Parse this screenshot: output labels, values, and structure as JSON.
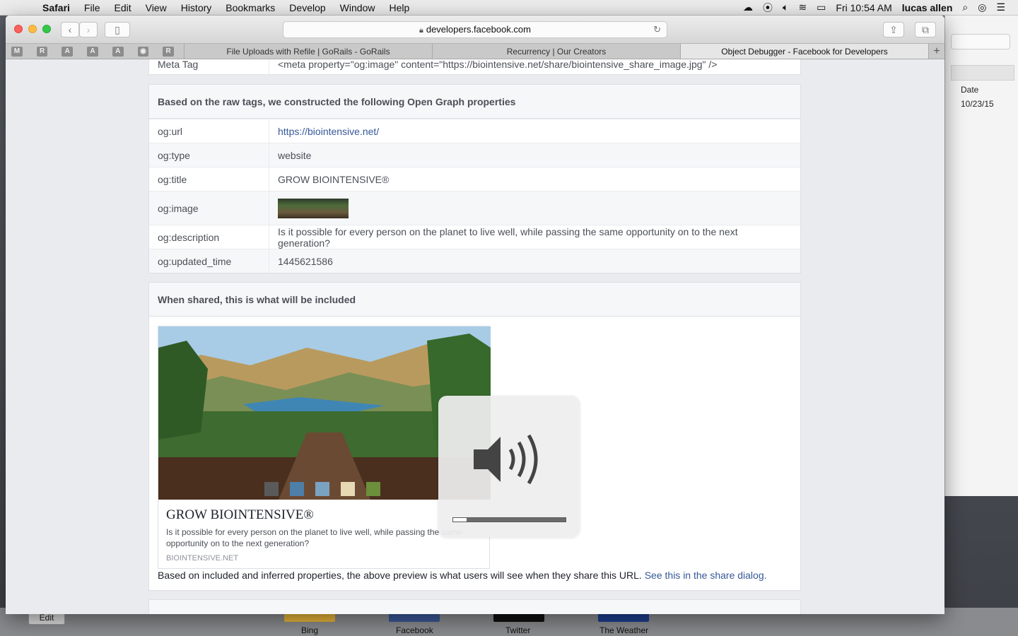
{
  "menubar": {
    "app": "Safari",
    "items": [
      "File",
      "Edit",
      "View",
      "History",
      "Bookmarks",
      "Develop",
      "Window",
      "Help"
    ],
    "clock": "Fri 10:54 AM",
    "user": "lucas allen"
  },
  "browser": {
    "address": "developers.facebook.com",
    "pinned_tabs": [
      "M",
      "R",
      "A",
      "A",
      "A",
      "",
      "R"
    ],
    "tabs": [
      {
        "label": "File Uploads with Refile | GoRails - GoRails",
        "active": false
      },
      {
        "label": "Recurrency | Our Creators",
        "active": false
      },
      {
        "label": "Object Debugger - Facebook for Developers",
        "active": true
      }
    ]
  },
  "meta_tag_row": {
    "key": "Meta Tag",
    "value": "<meta property=\"og:image\" content=\"https://biointensive.net/share/biointensive_share_image.jpg\" />"
  },
  "og_panel": {
    "heading": "Based on the raw tags, we constructed the following Open Graph properties",
    "rows": [
      {
        "key": "og:url",
        "value": "https://biointensive.net/"
      },
      {
        "key": "og:type",
        "value": "website"
      },
      {
        "key": "og:title",
        "value": "GROW BIOINTENSIVE®"
      },
      {
        "key": "og:image",
        "value": ""
      },
      {
        "key": "og:description",
        "value": "Is it possible for every person on the planet to live well, while passing the same opportunity on to the next generation?"
      },
      {
        "key": "og:updated_time",
        "value": "1445621586"
      }
    ]
  },
  "share_panel": {
    "heading": "When shared, this is what will be included",
    "preview_title": "GROW BIOINTENSIVE®",
    "preview_description": "Is it possible for every person on the planet to live well, while passing the same opportunity on to the next generation?",
    "preview_domain": "BIOINTENSIVE.NET",
    "note": "Based on included and inferred properties, the above preview is what users will see when they share this URL.",
    "note_link": "See this in the share dialog."
  },
  "background_window": {
    "column": "Date",
    "date": "10/23/15"
  },
  "dock": {
    "edit": "Edit",
    "labels": [
      "Bing",
      "Facebook",
      "Twitter",
      "The Weather"
    ]
  },
  "volume_hud": {
    "level": 0.12
  },
  "colors": {
    "link": "#365899",
    "page_bg": "#e9ebee"
  }
}
